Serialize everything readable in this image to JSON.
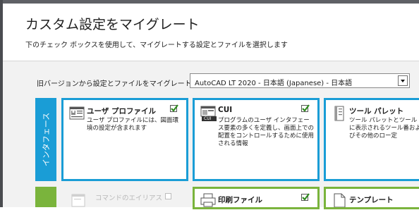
{
  "dialog": {
    "title": "カスタム設定をマイグレート",
    "subtitle": "下のチェック ボックスを使用して、マイグレートする設定とファイルを選択します"
  },
  "version_selector": {
    "label": "旧バージョンから設定とファイルをマイグレート:",
    "value": "AutoCAD LT 2020 - 日本語 (Japanese) - 日本語"
  },
  "categories": [
    {
      "label": "インタフェース",
      "color": "#1a9dd6"
    },
    {
      "label": "",
      "color": "#7ab43c"
    }
  ],
  "cards": {
    "user_profile": {
      "title": "ユーザ プロファイル",
      "desc": "ユーザ プロファイルには、図面環境の設定が含まれます",
      "checked": true,
      "icon": "user-profile-icon"
    },
    "cui": {
      "title": "CUI",
      "desc": "プログラムのユーザ インタフェース要素の多くを定義し、画面上での配置をコントロールするために使用される情報",
      "checked": true,
      "icon": "cui-icon",
      "icon_text": "CUI"
    },
    "tool_palette": {
      "title": "ツール パレット",
      "desc": "ツール パレットとツールトに表示されるツール番およびその他のロー定",
      "icon": "tool-palette-icon"
    },
    "command_alias": {
      "title": "コマンドのエイリアス",
      "checked": false,
      "disabled": true,
      "icon": "command-alias-icon"
    },
    "plot_files": {
      "title": "印刷ファイル",
      "checked": true,
      "icon": "plotter-icon"
    },
    "template": {
      "title": "テンプレート",
      "icon": "template-icon"
    }
  },
  "colors": {
    "accent_blue": "#1a9dd6",
    "accent_green": "#7ab43c",
    "check_green": "#2e8b1e"
  }
}
